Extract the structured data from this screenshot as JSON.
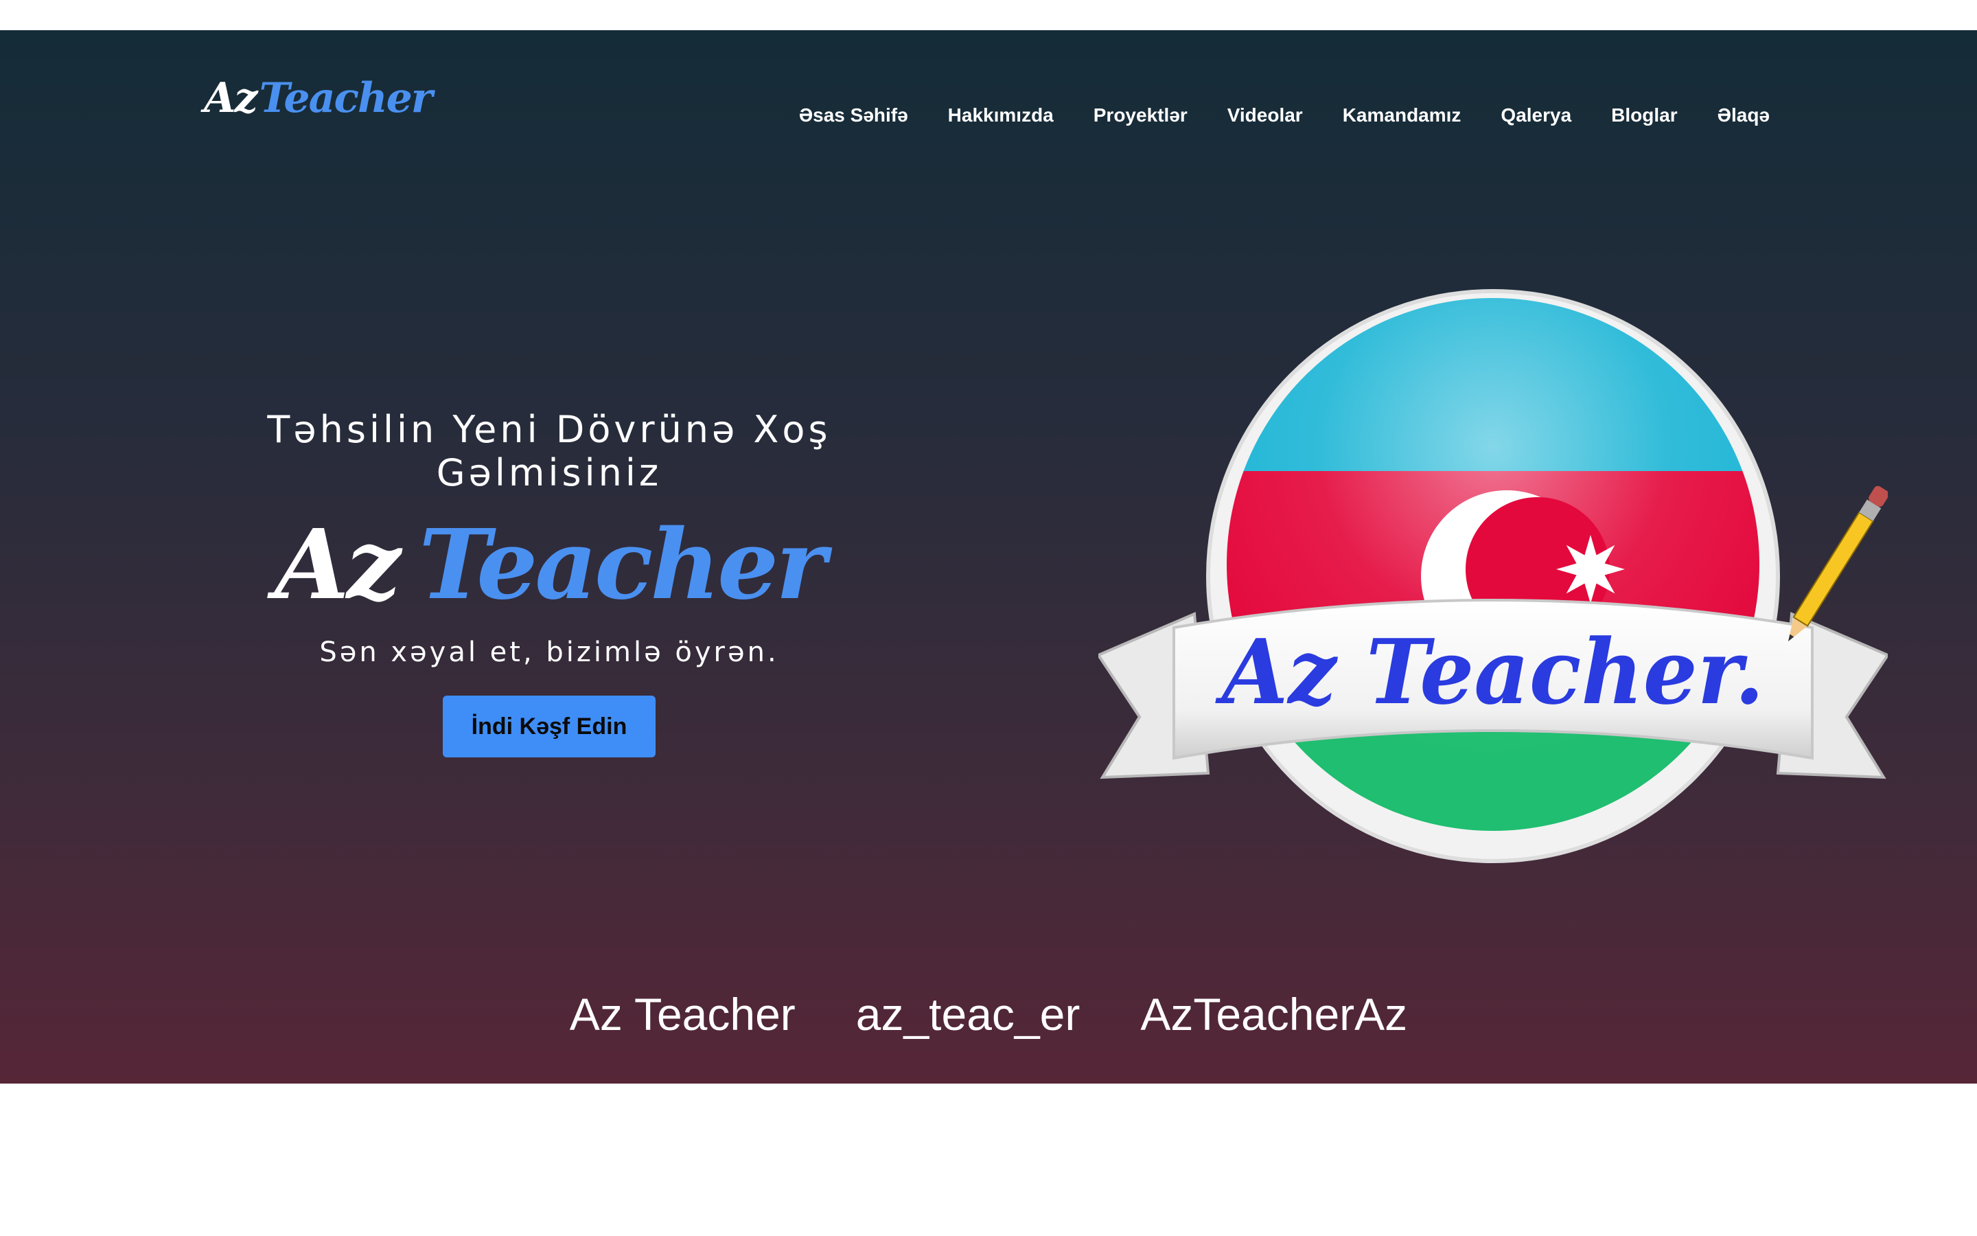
{
  "brand": {
    "part1": "Az",
    "part2": "Teacher"
  },
  "nav": {
    "items": [
      {
        "label": "Əsas Səhifə",
        "name": "nav-home"
      },
      {
        "label": "Hakkımızda",
        "name": "nav-about"
      },
      {
        "label": "Proyektlər",
        "name": "nav-projects"
      },
      {
        "label": "Videolar",
        "name": "nav-videos"
      },
      {
        "label": "Kamandamız",
        "name": "nav-team"
      },
      {
        "label": "Qalerya",
        "name": "nav-gallery"
      },
      {
        "label": "Bloglar",
        "name": "nav-blogs"
      },
      {
        "label": "Əlaqə",
        "name": "nav-contact"
      }
    ]
  },
  "hero": {
    "tagline": "Təhsilin Yeni Dövrünə Xoş Gəlmisiniz",
    "title_part1": "Az",
    "title_part2": "Teacher",
    "subtitle": "Sən xəyal et, bizimlə öyrən.",
    "cta": "İndi Kəşf Edin",
    "logo_text": "Az Teacher."
  },
  "socials": {
    "items": [
      {
        "label": "Az Teacher",
        "name": "social-facebook-link"
      },
      {
        "label": "az_teac_er",
        "name": "social-instagram-link"
      },
      {
        "label": "AzTeacherAz",
        "name": "social-youtube-link"
      }
    ]
  },
  "colors": {
    "accent": "#4a90f0",
    "flag_blue": "#1fb6d6",
    "flag_red": "#e4093c",
    "flag_green": "#1fbe70"
  }
}
